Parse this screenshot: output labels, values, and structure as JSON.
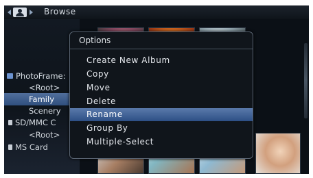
{
  "header": {
    "title": "Browse"
  },
  "tree": {
    "items": [
      {
        "label": "PhotoFrame:",
        "icon": "photoframe-device-icon"
      },
      {
        "label": "<Root>"
      },
      {
        "label": "Family",
        "selected": true
      },
      {
        "label": "Scenery"
      },
      {
        "label": "SD/MMC  C",
        "icon": "sd-card-icon"
      },
      {
        "label": "<Root>"
      },
      {
        "label": "MS  Card",
        "icon": "ms-card-icon"
      }
    ]
  },
  "options": {
    "title": "Options",
    "items": [
      {
        "label": "Create  New  Album"
      },
      {
        "label": "Copy"
      },
      {
        "label": "Move"
      },
      {
        "label": "Delete"
      },
      {
        "label": "Rename",
        "selected": true
      },
      {
        "label": "Group  By"
      },
      {
        "label": "Multiple-Select"
      }
    ]
  },
  "colors": {
    "selection": "#3d5f93",
    "dialog_border": "#596472",
    "background": "#0b1016"
  }
}
